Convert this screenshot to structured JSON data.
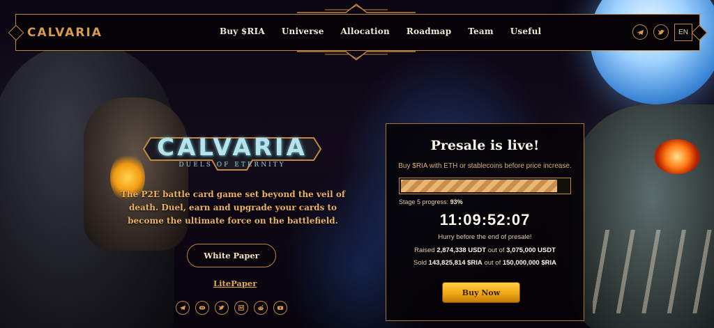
{
  "header": {
    "brand": "CALVARIA",
    "nav": [
      "Buy $RIA",
      "Universe",
      "Allocation",
      "Roadmap",
      "Team",
      "Useful"
    ],
    "social_icons": [
      "telegram-icon",
      "twitter-icon"
    ],
    "language": "EN"
  },
  "hero": {
    "logo_title": "CALVARIA",
    "logo_subtitle": "DUELS OF ETERNITY",
    "tagline": "The P2E battle card game set beyond the veil of death. Duel, earn and upgrade your cards to become the ultimate force on the battlefield.",
    "white_paper": "White Paper",
    "lite_paper": "LitePaper",
    "social_icons": [
      "telegram-icon",
      "discord-icon",
      "twitter-icon",
      "medium-icon",
      "reddit-icon",
      "youtube-icon"
    ]
  },
  "presale": {
    "title": "Presale is live!",
    "subtitle": "Buy $RIA with ETH or stablecoins before price increase.",
    "progress_fraction": 0.93,
    "stage_label": "Stage 5 progress:",
    "stage_value": "93%",
    "timer": "11:09:52:07",
    "hurry": "Hurry before the end of presale!",
    "raised_label": "Raised",
    "raised_value": "2,874,338 USDT",
    "raised_of": "out of",
    "raised_total": "3,075,000 USDT",
    "sold_label": "Sold",
    "sold_value": "143,825,814 $RIA",
    "sold_of": "out of",
    "sold_total": "150,000,000 $RIA",
    "buy_button": "Buy Now"
  },
  "colors": {
    "accent_gold": "#c2883f",
    "button_gold": "#f0a715",
    "tagline_gold": "#e9b25d"
  }
}
